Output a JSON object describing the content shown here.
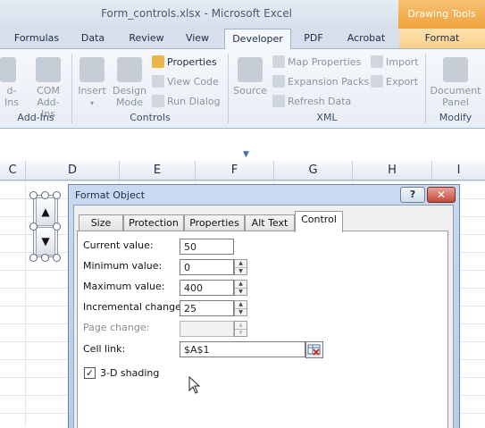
{
  "window": {
    "title": "Form_controls.xlsx - Microsoft Excel",
    "context_tab": "Drawing Tools"
  },
  "ribbon": {
    "tabs": [
      "Formulas",
      "Data",
      "Review",
      "View",
      "Developer",
      "PDF",
      "Acrobat",
      "Format"
    ],
    "active_tab": "Developer",
    "addins": {
      "partial_label": "d-Ins",
      "com_label": "COM Add-Ins",
      "group_label": "Add-Ins"
    },
    "controls": {
      "insert": "Insert",
      "design_mode": "Design Mode",
      "properties": "Properties",
      "view_code": "View Code",
      "run_dialog": "Run Dialog",
      "group_label": "Controls"
    },
    "xml": {
      "source": "Source",
      "map_properties": "Map Properties",
      "expansion_packs": "Expansion Packs",
      "refresh_data": "Refresh Data",
      "import": "Import",
      "export": "Export",
      "group_label": "XML"
    },
    "modify": {
      "document_panel": "Document Panel",
      "group_label": "Modify"
    }
  },
  "sheet": {
    "columns": [
      "C",
      "D",
      "E",
      "F",
      "G",
      "H",
      "I"
    ]
  },
  "spinner": {
    "up": "▲",
    "down": "▼"
  },
  "dialog": {
    "title": "Format Object",
    "help": "?",
    "close": "✕",
    "tabs": [
      "Size",
      "Protection",
      "Properties",
      "Alt Text",
      "Control"
    ],
    "active_tab": "Control",
    "fields": {
      "current_value": {
        "label": "Current value:",
        "value": "50"
      },
      "minimum_value": {
        "label": "Minimum value:",
        "value": "0"
      },
      "maximum_value": {
        "label": "Maximum value:",
        "value": "400"
      },
      "incremental_change": {
        "label": "Incremental change:",
        "value": "25"
      },
      "page_change": {
        "label": "Page change:",
        "value": ""
      },
      "cell_link": {
        "label": "Cell link:",
        "value": "$A$1"
      }
    },
    "shading": {
      "label": "3-D shading",
      "checked": true,
      "checkmark": "✓"
    }
  }
}
